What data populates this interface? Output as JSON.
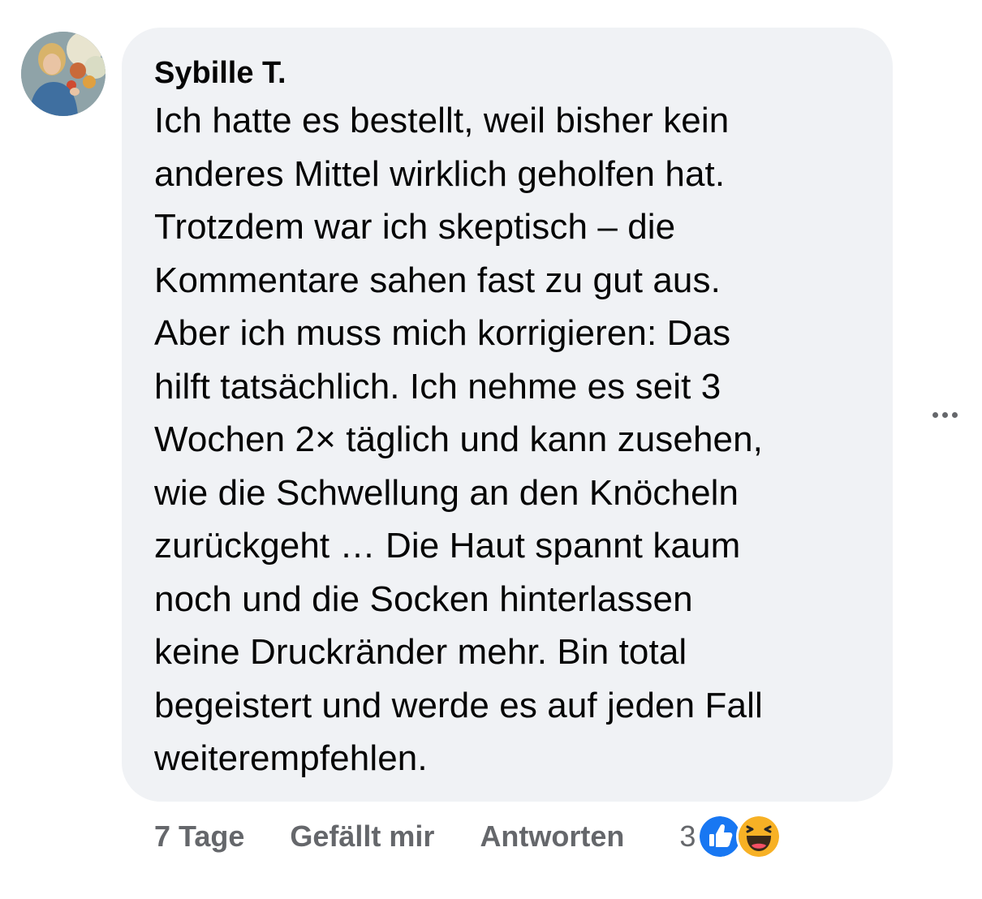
{
  "comment": {
    "author": "Sybille T.",
    "text": "Ich hatte es bestellt, weil bisher kein\nanderes Mittel wirklich geholfen hat.\nTrotzdem war ich skeptisch – die\nKommentare sahen fast zu gut aus.\nAber ich muss mich korrigieren: Das\nhilft tatsächlich. Ich nehme es seit 3\nWochen 2× täglich und kann zusehen,\nwie die Schwellung an den Knöcheln\nzurückgeht … Die Haut spannt kaum\nnoch und die Socken hinterlassen\nkeine Druckränder mehr. Bin total\nbegeistert und werde es auf jeden Fall\nweiterempfehlen."
  },
  "actions": {
    "timestamp": "7 Tage",
    "like_label": "Gefällt mir",
    "reply_label": "Antworten"
  },
  "reactions": {
    "count": "3",
    "icons": [
      "like-reaction-icon",
      "haha-reaction-icon"
    ]
  },
  "colors": {
    "bubble": "#f0f2f5",
    "text": "#050505",
    "secondary": "#65676b",
    "like_blue": "#1877f2",
    "haha_yellow": "#f7b125"
  }
}
